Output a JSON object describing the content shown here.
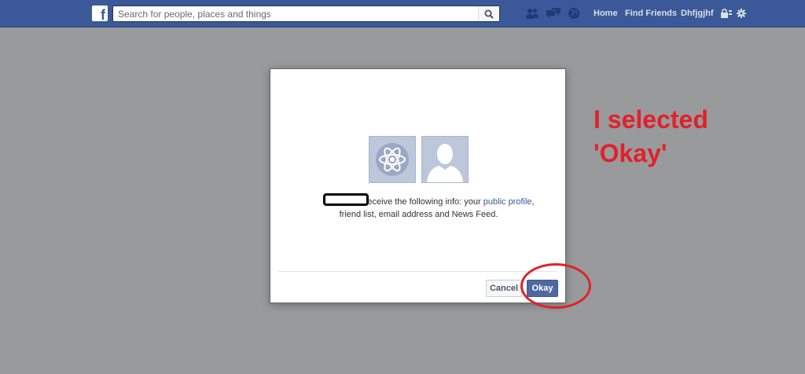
{
  "topbar": {
    "logo": "f",
    "search": {
      "placeholder": "Search for people, places and things",
      "value": ""
    },
    "links": {
      "home": "Home",
      "find_friends": "Find Friends",
      "username": "Dhfjgjhf"
    },
    "icons": [
      "friend-requests-icon",
      "messages-icon",
      "notifications-icon",
      "privacy-icon",
      "settings-icon"
    ]
  },
  "dialog": {
    "message_text": "will receive the following info: your",
    "public_profile_link": "public profile",
    "message_text_2": ", friend list, email address and News Feed.",
    "buttons": {
      "cancel": "Cancel",
      "okay": "Okay"
    }
  },
  "annotation": {
    "line1": "I selected",
    "line2": "'Okay'"
  },
  "colors": {
    "topbar": "#3b5998",
    "overlay": "#999a9c",
    "primary_button": "#4e69a2",
    "annotation": "#e3202a"
  }
}
